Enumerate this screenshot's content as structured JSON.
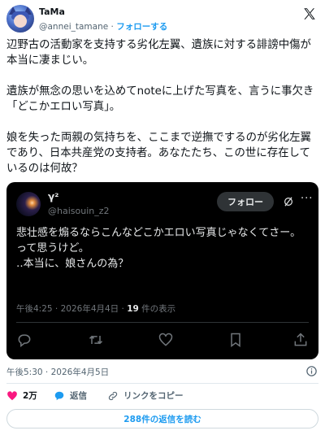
{
  "author": {
    "name": "TaMa",
    "handle": "@annei_tamane",
    "separator": "·",
    "follow_label": "フォローする"
  },
  "tweet": {
    "text": "辺野古の活動家を支持する劣化左翼、遺族に対する誹謗中傷が本当に凄まじい。\n\n遺族が無念の思いを込めてnoteに上げた写真を、言うに事欠き「どこかエロい写真」。\n\n娘を失った両親の気持ちを、ここまで逆撫でするのが劣化左翼であり、日本共産党の支持者。あなたたち、この世に存在しているのは何故？",
    "timestamp": "午後5:30 · 2026年4月5日",
    "likes": "2万",
    "reply_label": "返信",
    "copy_link_label": "リンクをコピー",
    "read_replies_label": "288件の返信を読む"
  },
  "quoted": {
    "name": "γ²",
    "handle": "@haisouin_z2",
    "follow_label": "フォロー",
    "text": "悲壮感を煽るならこんなどこかエロい写真じゃなくてさー。\nって思うけど。\n‥本当に、娘さんの為？",
    "meta_time": "午後4:25 · 2026年4月4日 · ",
    "views": "19",
    "views_suffix": " 件の表示"
  },
  "colors": {
    "accent": "#1d9bf0",
    "like": "#f91880",
    "quote_bg": "#000000"
  },
  "icons": [
    "x-logo-icon",
    "grok-icon",
    "more-icon",
    "reply-icon",
    "retweet-icon",
    "heart-icon",
    "bookmark-icon",
    "share-icon",
    "info-icon",
    "link-icon"
  ]
}
